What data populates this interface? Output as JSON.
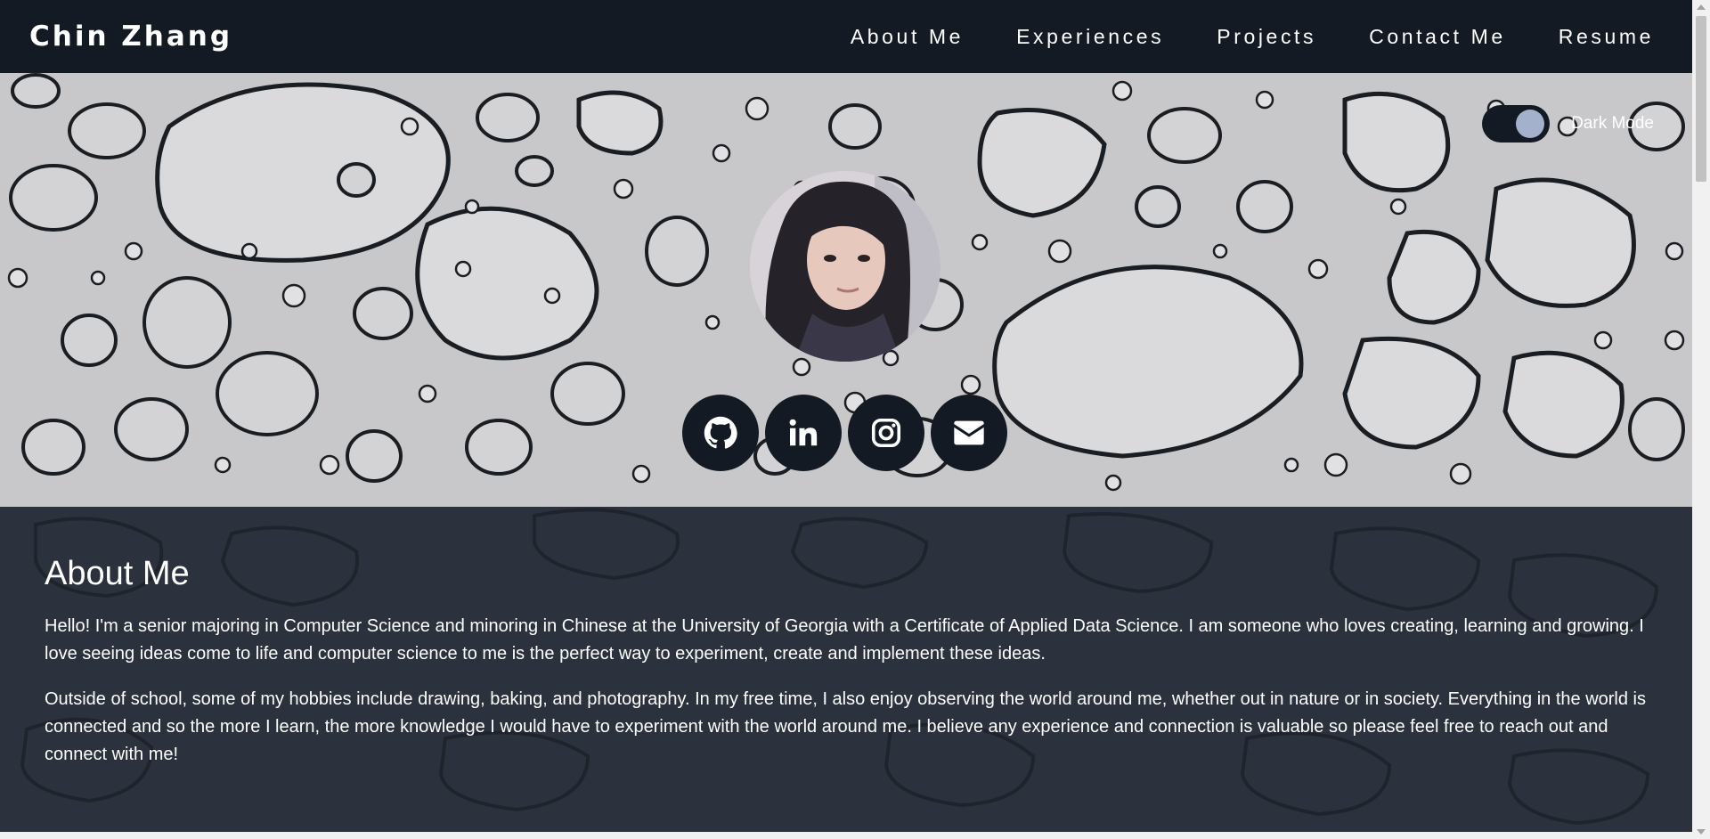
{
  "navbar": {
    "brand": "Chin Zhang",
    "links": [
      "About Me",
      "Experiences",
      "Projects",
      "Contact Me",
      "Resume"
    ]
  },
  "hero": {
    "toggle_label": "Dark Mode",
    "toggle_on": true,
    "socials": [
      "github-icon",
      "linkedin-icon",
      "instagram-icon",
      "envelope-icon"
    ]
  },
  "about": {
    "title": "About Me",
    "paragraphs": [
      "Hello! I'm a senior majoring in Computer Science and minoring in Chinese at the University of Georgia with a Certificate of Applied Data Science. I am someone who loves creating, learning and growing. I love seeing ideas come to life and computer science to me is the perfect way to experiment, create and implement these ideas.",
      "Outside of school, some of my hobbies include drawing, baking, and photography. In my free time, I also enjoy observing the world around me, whether out in nature or in society. Everything in the world is connected and so the more I learn, the more knowledge I would have to experiment with the world around me. I believe any experience and connection is valuable so please feel free to reach out and connect with me!"
    ]
  },
  "colors": {
    "navbar": "#131a23",
    "about_bg": "#2b323d",
    "toggle_knob": "#a3b1cc",
    "text": "#ffffff"
  }
}
